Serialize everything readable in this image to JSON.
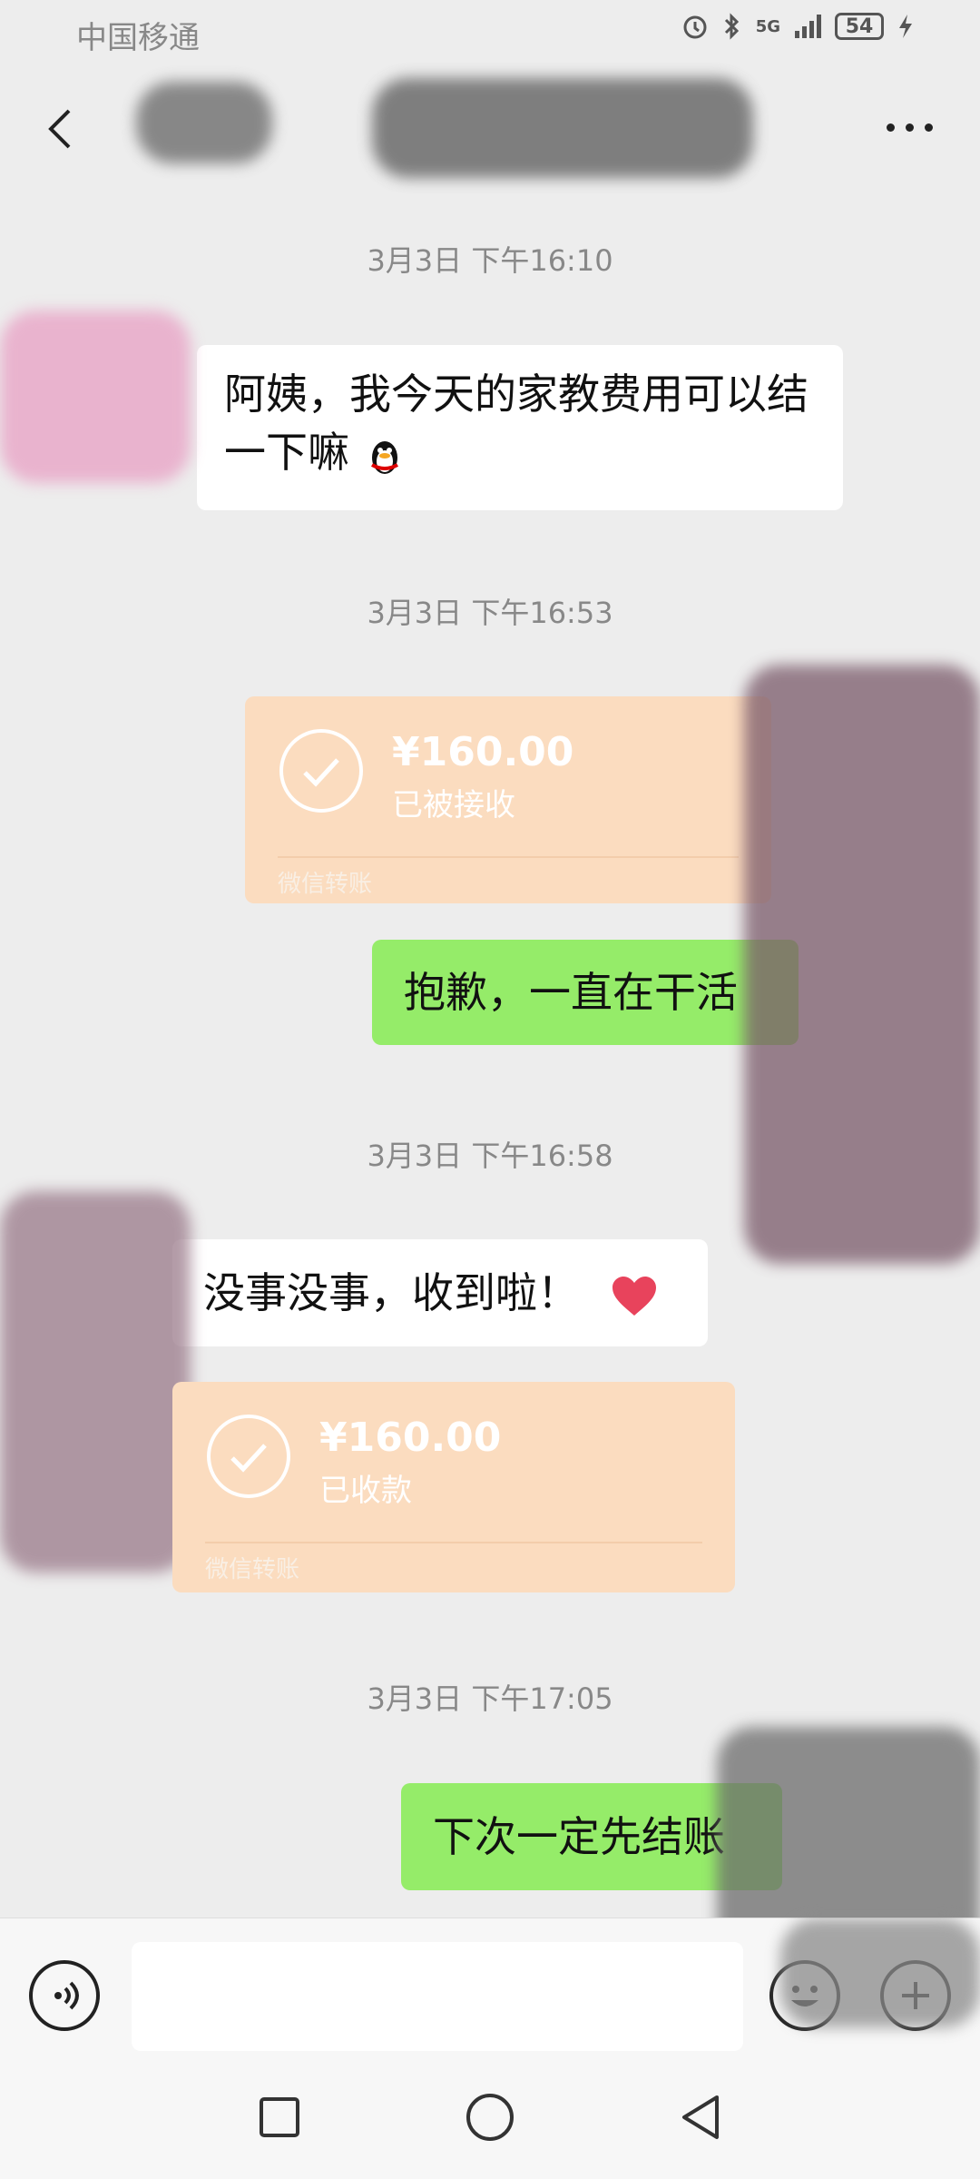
{
  "status_bar": {
    "carrier": "中国移通",
    "network": "5G",
    "battery": "54"
  },
  "header": {
    "title": ""
  },
  "messages": [
    {
      "time": "3月3日 下午16:10"
    },
    {
      "text": "阿姨，我今天的家教费用可以结一下嘛",
      "emoji": "penguin-emoji"
    },
    {
      "time": "3月3日 下午16:53"
    },
    {
      "transfer": {
        "amount": "¥160.00",
        "status": "已被接收",
        "brand": "微信转账"
      }
    },
    {
      "text": "抱歉，一直在干活"
    },
    {
      "time": "3月3日 下午16:58"
    },
    {
      "text": "没事没事，收到啦！",
      "emoji": "heart-emoji"
    },
    {
      "transfer": {
        "amount": "¥160.00",
        "status": "已收款",
        "brand": "微信转账"
      }
    },
    {
      "time": "3月3日 下午17:05"
    },
    {
      "text": "下次一定先结账"
    }
  ],
  "colors": {
    "background": "#ededed",
    "sent_bubble": "#95ec69",
    "received_bubble": "#ffffff",
    "transfer": "#fbdcbf",
    "timestamp": "#888888"
  },
  "icons": [
    "back-arrow-icon",
    "more-icon",
    "voice-icon",
    "emoji-icon",
    "plus-icon",
    "recent-apps-icon",
    "home-icon",
    "nav-back-icon"
  ]
}
